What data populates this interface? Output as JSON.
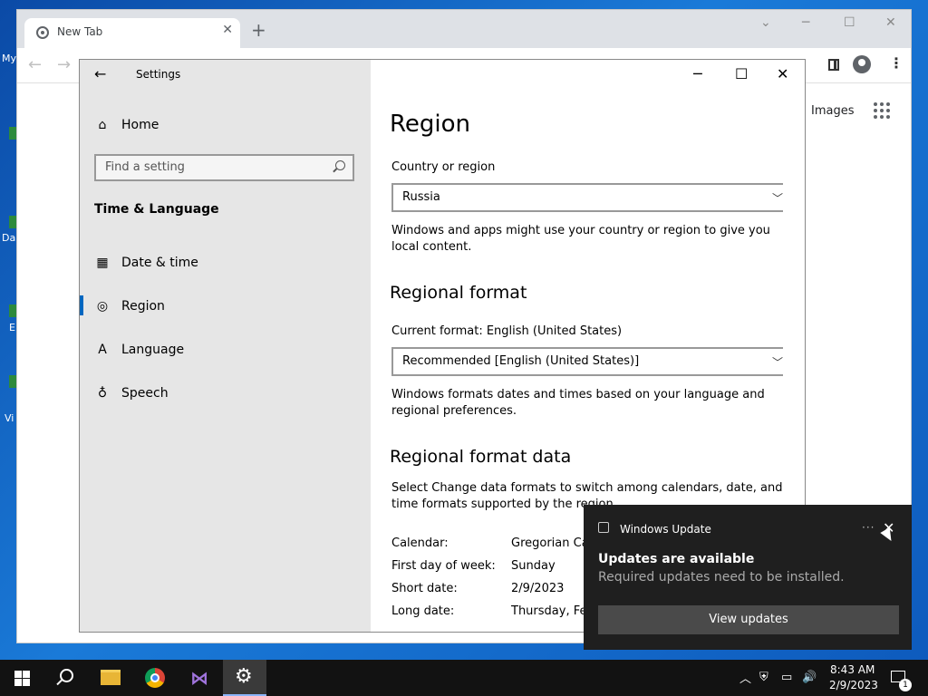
{
  "desktop": {
    "labels": [
      "My",
      "Da",
      "E",
      "Vi"
    ]
  },
  "chrome": {
    "tab_title": "New Tab",
    "tab_close": "✕",
    "new_tab": "+",
    "images_link": "Images",
    "minimize": "─",
    "maximize": "☐",
    "close": "✕",
    "dropdown": "⌄",
    "back": "←",
    "forward": "→",
    "menu": "⋮"
  },
  "settings": {
    "window_title": "Settings",
    "back": "←",
    "minimize": "─",
    "maximize": "☐",
    "close": "✕",
    "home_label": "Home",
    "search_placeholder": "Find a setting",
    "section_heading": "Time & Language",
    "nav_items": [
      {
        "label": "Date & time",
        "icon": "calendar-clock-icon"
      },
      {
        "label": "Region",
        "icon": "globe-icon",
        "selected": true
      },
      {
        "label": "Language",
        "icon": "language-icon"
      },
      {
        "label": "Speech",
        "icon": "microphone-icon"
      }
    ],
    "accent_color": "#0067c0",
    "main": {
      "page_title": "Region",
      "country_label": "Country or region",
      "country_value": "Russia",
      "country_desc": "Windows and apps might use your country or region to give you local content.",
      "format_heading": "Regional format",
      "current_format_label": "Current format: English (United States)",
      "format_value": "Recommended [English (United States)]",
      "format_desc": "Windows formats dates and times based on your language and regional preferences.",
      "format_data_heading": "Regional format data",
      "format_data_desc": "Select Change data formats to switch among calendars, date, and time formats supported by the region.",
      "data_rows": [
        {
          "key": "Calendar:",
          "value": "Gregorian Ca"
        },
        {
          "key": "First day of week:",
          "value": "Sunday"
        },
        {
          "key": "Short date:",
          "value": "2/9/2023"
        },
        {
          "key": "Long date:",
          "value": "Thursday, Feb"
        }
      ]
    }
  },
  "toast": {
    "app_name": "Windows Update",
    "more": "···",
    "close": "✕",
    "title": "Updates are available",
    "body": "Required updates need to be installed.",
    "button": "View updates"
  },
  "taskbar": {
    "settings_icon": "⚙",
    "vs_icon": "⋈",
    "tray_chevron": "︿",
    "tray_volume": "🔊",
    "clock_time": "8:43 AM",
    "clock_date": "2/9/2023",
    "notification_count": "1"
  }
}
